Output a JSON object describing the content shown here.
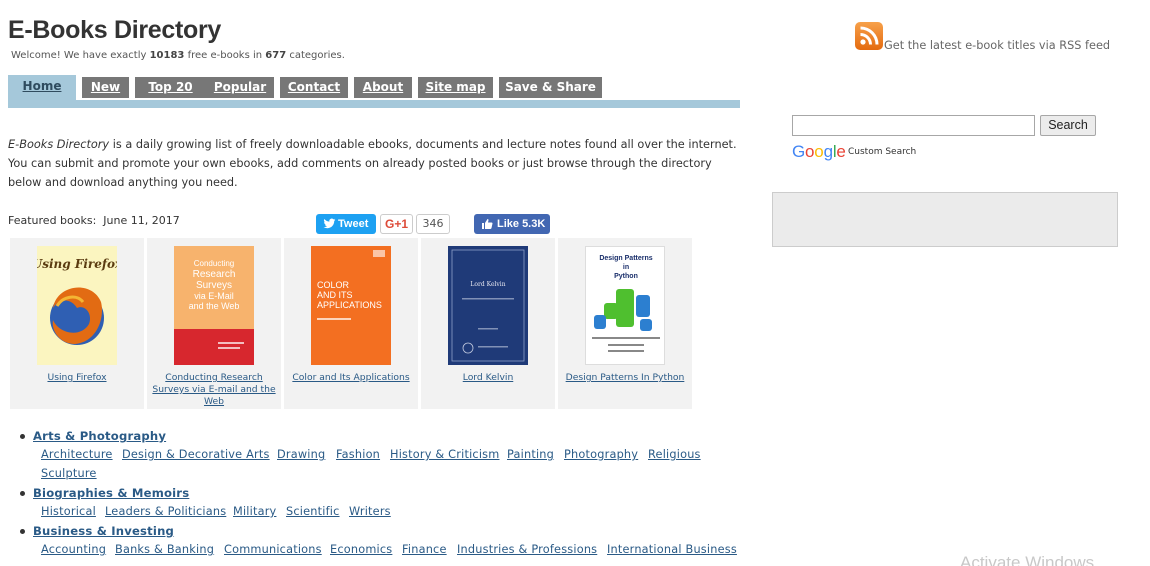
{
  "header": {
    "site_title": "E-Books Directory",
    "welcome_prefix": "Welcome! We have exactly ",
    "ebook_count": "10183",
    "welcome_mid": " free e-books in ",
    "category_count": "677",
    "welcome_suffix": " categories."
  },
  "nav": {
    "tabs": [
      {
        "label": "Home",
        "active": true
      },
      {
        "label": "New"
      },
      {
        "label": "Top 20"
      },
      {
        "label": "Popular"
      },
      {
        "label": "Contact"
      },
      {
        "label": "About"
      },
      {
        "label": "Site map"
      },
      {
        "label": "Save & Share"
      }
    ]
  },
  "intro": {
    "site_name": "E-Books Directory",
    "line1_rest": " is a daily growing list of freely downloadable ebooks, documents and lecture notes found all over the internet.",
    "line2": "You can submit and promote your own ebooks, add comments on already posted books or just browse through the directory",
    "line3": "below and download anything you need."
  },
  "featured": {
    "label": "Featured books:",
    "date": "June 11, 2017"
  },
  "social": {
    "tweet_label": "Tweet",
    "gplus_label": "G+1",
    "gplus_count": "346",
    "like_label": "Like 5.3K",
    "colors": {
      "twitter": "#1da1f2",
      "facebook": "#4267b2",
      "gplus": "#dd4b39"
    }
  },
  "books": [
    {
      "title": "Using Firefox",
      "cover_text": "Using Firefox"
    },
    {
      "title_line1": "Conducting Research",
      "title_line2": "Surveys via E-mail and the",
      "title_line3": "Web",
      "cover_text1": "Conducting",
      "cover_text2": "Research",
      "cover_text3": "Surveys",
      "cover_text4": "via E-Mail",
      "cover_text5": "and the Web"
    },
    {
      "title": "Color and Its Applications",
      "cover_text1": "COLOR",
      "cover_text2": "AND ITS",
      "cover_text3": "APPLICATIONS"
    },
    {
      "title": "Lord Kelvin",
      "cover_text": "Lord Kelvin"
    },
    {
      "title": "Design Patterns In Python",
      "cover_text1": "Design Patterns",
      "cover_text2": "in",
      "cover_text3": "Python"
    }
  ],
  "categories": [
    {
      "name": "Arts & Photography",
      "subs": [
        "Architecture",
        "Design & Decorative Arts",
        "Drawing",
        "Fashion",
        "History & Criticism",
        "Painting",
        "Photography",
        "Religious",
        "Sculpture"
      ]
    },
    {
      "name": "Biographies & Memoirs",
      "subs": [
        "Historical",
        "Leaders & Politicians",
        "Military",
        "Scientific",
        "Writers"
      ]
    },
    {
      "name": "Business & Investing",
      "subs": [
        "Accounting",
        "Banks & Banking",
        "Communications",
        "Economics",
        "Finance",
        "Industries & Professions",
        "International Business"
      ]
    }
  ],
  "sidebar": {
    "rss_text": "Get the latest e-book titles via RSS feed",
    "search_button": "Search",
    "search_value": "",
    "custom_search": "Custom Search",
    "google_letters": [
      "G",
      "o",
      "o",
      "g",
      "l",
      "e"
    ],
    "google_colors": [
      "#4285f4",
      "#ea4335",
      "#fbbc05",
      "#4285f4",
      "#34a853",
      "#ea4335"
    ]
  },
  "watermark": "Activate Windows"
}
